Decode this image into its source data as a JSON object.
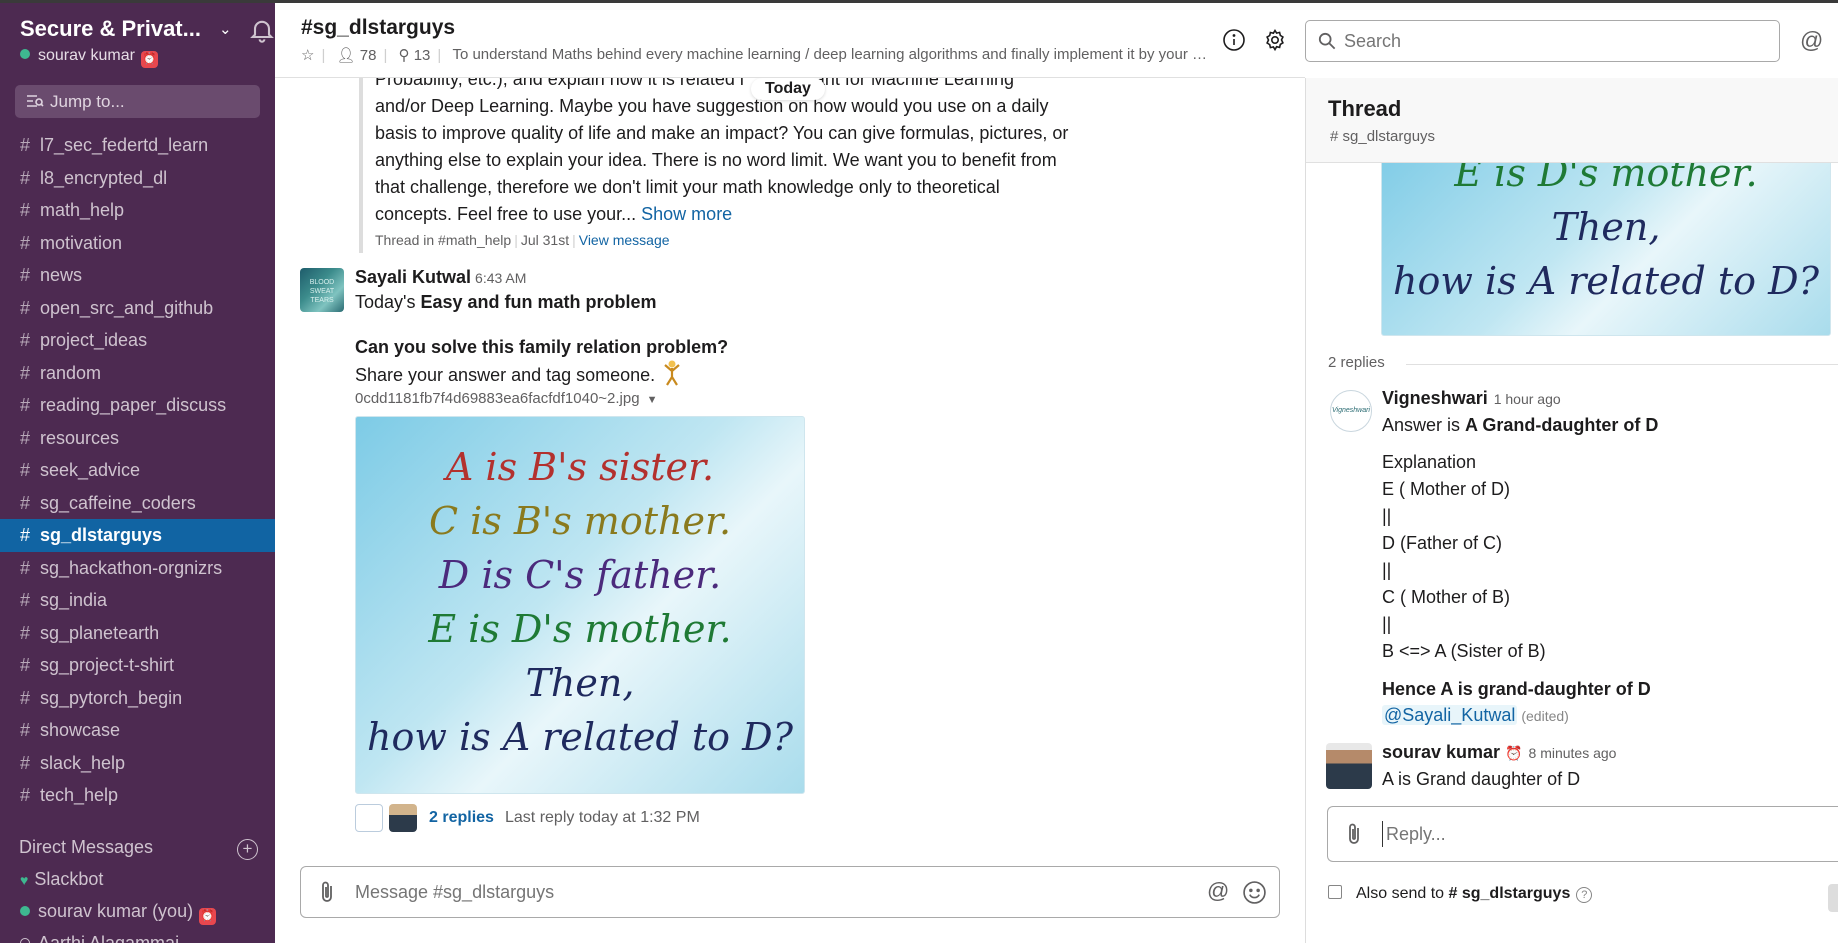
{
  "workspace": {
    "name": "Secure & Privat...",
    "user": "sourav kumar"
  },
  "sidebar": {
    "jump_to": "Jump to...",
    "channels": [
      {
        "label": "l7_sec_federtd_learn"
      },
      {
        "label": "l8_encrypted_dl"
      },
      {
        "label": "math_help"
      },
      {
        "label": "motivation"
      },
      {
        "label": "news"
      },
      {
        "label": "open_src_and_github"
      },
      {
        "label": "project_ideas"
      },
      {
        "label": "random"
      },
      {
        "label": "reading_paper_discuss"
      },
      {
        "label": "resources"
      },
      {
        "label": "seek_advice"
      },
      {
        "label": "sg_caffeine_coders"
      },
      {
        "label": "sg_dlstarguys",
        "active": true
      },
      {
        "label": "sg_hackathon-orgnizrs"
      },
      {
        "label": "sg_india"
      },
      {
        "label": "sg_planetearth"
      },
      {
        "label": "sg_project-t-shirt"
      },
      {
        "label": "sg_pytorch_begin"
      },
      {
        "label": "showcase"
      },
      {
        "label": "slack_help"
      },
      {
        "label": "tech_help"
      }
    ],
    "dm_header": "Direct Messages",
    "dms": [
      {
        "label": "Slackbot"
      },
      {
        "label": "sourav kumar",
        "suffix": "(you)"
      },
      {
        "label": "Aarthi Alagammai"
      }
    ]
  },
  "channel_header": {
    "title": "#sg_dlstarguys",
    "members": "78",
    "pins": "13",
    "topic": "To understand Maths behind every machine learning / deep learning algorithms and finally implement it by your own"
  },
  "search": {
    "placeholder": "Search"
  },
  "messages": {
    "quote": {
      "line1": "Probability, etc.), and explain how it is related i",
      "line1b": "tant for Machine Learning",
      "line2": "and/or Deep Learning. Maybe you have suggestion on how would you use on a daily",
      "line3": "basis to improve quality of life and make an impact? You can give formulas, pictures, or",
      "line4": "anything else to explain your idea. There is no word limit. We want you to benefit from",
      "line5": "that challenge, therefore we don't limit your math knowledge only to theoretical",
      "line6": "concepts. Feel free to use your...",
      "show_more": "Show more",
      "thread_in": "Thread in #math_help",
      "date": "Jul 31st",
      "view_message": "View message"
    },
    "today_label": "Today",
    "post": {
      "author": "Sayali Kutwal",
      "time": "6:43 AM",
      "avatar_text": "BLOOD SWEAT TEARS",
      "line1_prefix": "Today's ",
      "line1_bold": "Easy and fun math problem",
      "question": "Can you solve this family relation problem?",
      "share": "Share your answer and tag someone.",
      "file_name": "0cdd1181fb7f4d69883ea6facfdf1040~2.jpg",
      "image_lines": [
        {
          "text": "A is B's sister.",
          "color": "#b3312e"
        },
        {
          "text": "C is B's mother.",
          "color": "#8a7a1e"
        },
        {
          "text": "D is C's father.",
          "color": "#4b2a7c"
        },
        {
          "text": "E is D's mother.",
          "color": "#1f7a35"
        },
        {
          "text": "Then,",
          "color": "#1f2a5e"
        },
        {
          "text": "how is A related to D?",
          "color": "#1f2a5e"
        }
      ],
      "replies": "2 replies",
      "last_reply": "Last reply today at 1:32 PM"
    }
  },
  "composer": {
    "placeholder": "Message #sg_dlstarguys"
  },
  "thread": {
    "title": "Thread",
    "channel": "# sg_dlstarguys",
    "image_lines": [
      "E is D's mother.",
      "Then,",
      "how is A related to D?"
    ],
    "replies_count": "2 replies",
    "reply1": {
      "author": "Vigneshwari",
      "avatar_text": "Vigneshwari",
      "time": "1 hour ago",
      "answer_prefix": "Answer is ",
      "answer_bold": "A Grand-daughter of D",
      "explanation": "Explanation",
      "e": "E ( Mother of D)",
      "bar1": "||",
      "d": "D (Father of C)",
      "bar2": "||",
      "c": "C ( Mother of B)",
      "bar3": "||",
      "b": "B <=> A (Sister of B)",
      "hence": "Hence A is grand-daughter of D",
      "mention": "@Sayali_Kutwal",
      "edited": "(edited)"
    },
    "reply2": {
      "author": "sourav kumar",
      "time": "8 minutes ago",
      "text": "A is Grand daughter of D"
    },
    "reply_placeholder": "Reply...",
    "also_send_prefix": "Also send to",
    "also_send_channel": "# sg_dlstarguys"
  },
  "colors": {
    "sidebar": "#4d2a51",
    "active": "#1164a3",
    "link": "#1264a3"
  }
}
